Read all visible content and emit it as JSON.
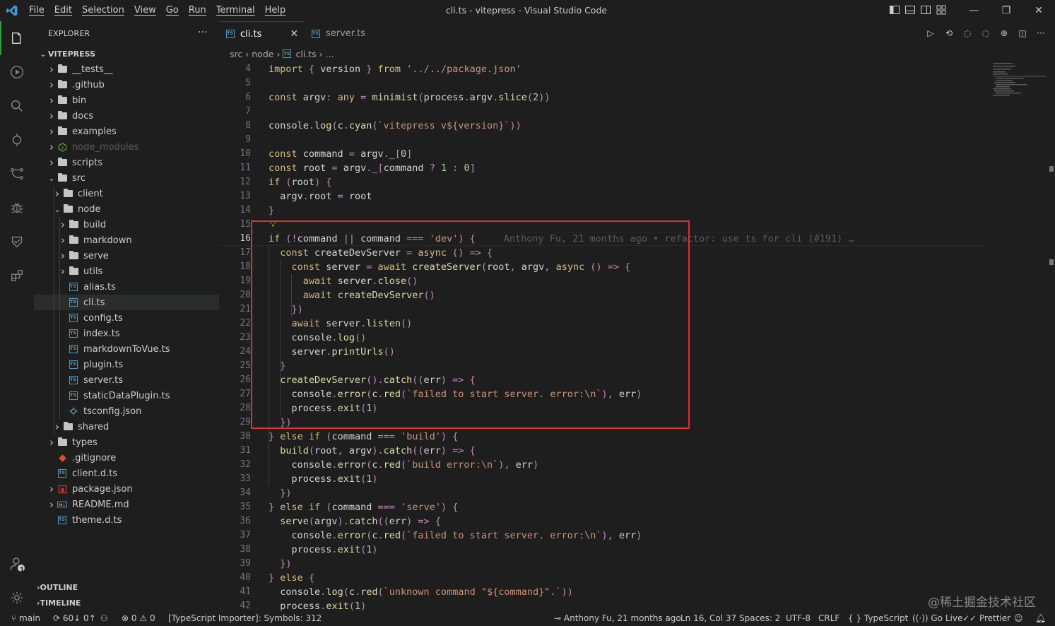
{
  "window": {
    "title": "cli.ts - vitepress - Visual Studio Code",
    "menu": [
      "File",
      "Edit",
      "Selection",
      "View",
      "Go",
      "Run",
      "Terminal",
      "Help"
    ]
  },
  "colors": {
    "accent": "#2ea043",
    "ts_blue": "#519aba",
    "highlight_box": "#e32f2f"
  },
  "explorer": {
    "title": "EXPLORER",
    "more": "···",
    "root": "VITEPRESS",
    "rows": [
      {
        "label": "__tests__",
        "kind": "folder",
        "depth": 0,
        "open": false
      },
      {
        "label": ".github",
        "kind": "folder",
        "depth": 0,
        "open": false
      },
      {
        "label": "bin",
        "kind": "folder",
        "depth": 0,
        "open": false
      },
      {
        "label": "docs",
        "kind": "folder",
        "depth": 0,
        "open": false
      },
      {
        "label": "examples",
        "kind": "folder",
        "depth": 0,
        "open": false
      },
      {
        "label": "node_modules",
        "kind": "node",
        "depth": 0,
        "open": false,
        "dim": true
      },
      {
        "label": "scripts",
        "kind": "folder",
        "depth": 0,
        "open": false
      },
      {
        "label": "src",
        "kind": "folder",
        "depth": 0,
        "open": true
      },
      {
        "label": "client",
        "kind": "folder",
        "depth": 1,
        "open": false
      },
      {
        "label": "node",
        "kind": "folder",
        "depth": 1,
        "open": true
      },
      {
        "label": "build",
        "kind": "folder",
        "depth": 2,
        "open": false
      },
      {
        "label": "markdown",
        "kind": "folder",
        "depth": 2,
        "open": false
      },
      {
        "label": "serve",
        "kind": "folder",
        "depth": 2,
        "open": false
      },
      {
        "label": "utils",
        "kind": "folder",
        "depth": 2,
        "open": false
      },
      {
        "label": "alias.ts",
        "kind": "ts",
        "depth": 2
      },
      {
        "label": "cli.ts",
        "kind": "ts",
        "depth": 2,
        "selected": true
      },
      {
        "label": "config.ts",
        "kind": "ts",
        "depth": 2
      },
      {
        "label": "index.ts",
        "kind": "ts",
        "depth": 2
      },
      {
        "label": "markdownToVue.ts",
        "kind": "ts",
        "depth": 2
      },
      {
        "label": "plugin.ts",
        "kind": "ts",
        "depth": 2
      },
      {
        "label": "server.ts",
        "kind": "ts",
        "depth": 2
      },
      {
        "label": "staticDataPlugin.ts",
        "kind": "ts",
        "depth": 2
      },
      {
        "label": "tsconfig.json",
        "kind": "tsconfig",
        "depth": 2
      },
      {
        "label": "shared",
        "kind": "folder",
        "depth": 1,
        "open": false
      },
      {
        "label": "types",
        "kind": "folder",
        "depth": 0,
        "open": false
      },
      {
        "label": ".gitignore",
        "kind": "git",
        "depth": 0
      },
      {
        "label": "client.d.ts",
        "kind": "ts",
        "depth": 0
      },
      {
        "label": "package.json",
        "kind": "npm",
        "depth": 0,
        "open": false
      },
      {
        "label": "README.md",
        "kind": "md",
        "depth": 0,
        "open": false
      },
      {
        "label": "theme.d.ts",
        "kind": "ts",
        "depth": 0
      }
    ],
    "outline": "OUTLINE",
    "timeline": "TIMELINE"
  },
  "tabs": [
    {
      "label": "cli.ts",
      "active": true
    },
    {
      "label": "server.ts",
      "active": false
    }
  ],
  "breadcrumb": [
    "src",
    "node",
    "cli.ts",
    "..."
  ],
  "editor": {
    "current_line": 16,
    "blame": "Anthony Fu, 21 months ago • refactor: use ts for cli (#191) …",
    "lines": [
      {
        "n": 4,
        "text": "import { version } from '../../package.json'"
      },
      {
        "n": 5,
        "text": ""
      },
      {
        "n": 6,
        "text": "const argv: any = minimist(process.argv.slice(2))"
      },
      {
        "n": 7,
        "text": ""
      },
      {
        "n": 8,
        "text": "console.log(c.cyan(`vitepress v${version}`))"
      },
      {
        "n": 9,
        "text": ""
      },
      {
        "n": 10,
        "text": "const command = argv._[0]"
      },
      {
        "n": 11,
        "text": "const root = argv._[command ? 1 : 0]"
      },
      {
        "n": 12,
        "text": "if (root) {"
      },
      {
        "n": 13,
        "text": "  argv.root = root"
      },
      {
        "n": 14,
        "text": "}"
      },
      {
        "n": 15,
        "text": ""
      },
      {
        "n": 16,
        "text": "if (!command || command === 'dev') {"
      },
      {
        "n": 17,
        "text": "  const createDevServer = async () => {"
      },
      {
        "n": 18,
        "text": "    const server = await createServer(root, argv, async () => {"
      },
      {
        "n": 19,
        "text": "      await server.close()"
      },
      {
        "n": 20,
        "text": "      await createDevServer()"
      },
      {
        "n": 21,
        "text": "    })"
      },
      {
        "n": 22,
        "text": "    await server.listen()"
      },
      {
        "n": 23,
        "text": "    console.log()"
      },
      {
        "n": 24,
        "text": "    server.printUrls()"
      },
      {
        "n": 25,
        "text": "  }"
      },
      {
        "n": 26,
        "text": "  createDevServer().catch((err) => {"
      },
      {
        "n": 27,
        "text": "    console.error(c.red(`failed to start server. error:\\n`), err)"
      },
      {
        "n": 28,
        "text": "    process.exit(1)"
      },
      {
        "n": 29,
        "text": "  })"
      },
      {
        "n": 30,
        "text": "} else if (command === 'build') {"
      },
      {
        "n": 31,
        "text": "  build(root, argv).catch((err) => {"
      },
      {
        "n": 32,
        "text": "    console.error(c.red(`build error:\\n`), err)"
      },
      {
        "n": 33,
        "text": "    process.exit(1)"
      },
      {
        "n": 34,
        "text": "  })"
      },
      {
        "n": 35,
        "text": "} else if (command === 'serve') {"
      },
      {
        "n": 36,
        "text": "  serve(argv).catch((err) => {"
      },
      {
        "n": 37,
        "text": "    console.error(c.red(`failed to start server. error:\\n`), err)"
      },
      {
        "n": 38,
        "text": "    process.exit(1)"
      },
      {
        "n": 39,
        "text": "  })"
      },
      {
        "n": 40,
        "text": "} else {"
      },
      {
        "n": 41,
        "text": "  console.log(c.red(`unknown command \"${command}\".`))"
      },
      {
        "n": 42,
        "text": "  process.exit(1)"
      }
    ]
  },
  "statusbar": {
    "branch": "main",
    "sync": "60↓ 0↑",
    "errors": "0",
    "warnings": "0",
    "importer": "[TypeScript Importer]: Symbols: 312",
    "blame": "Anthony Fu, 21 months ago",
    "position": "Ln 16, Col 37",
    "spaces": "Spaces: 2",
    "encoding": "UTF-8",
    "eol": "CRLF",
    "language": "TypeScript",
    "golive": "Go Live",
    "prettier": "Prettier"
  },
  "accounts_badge": "1",
  "watermark": "@稀土掘金技术社区"
}
